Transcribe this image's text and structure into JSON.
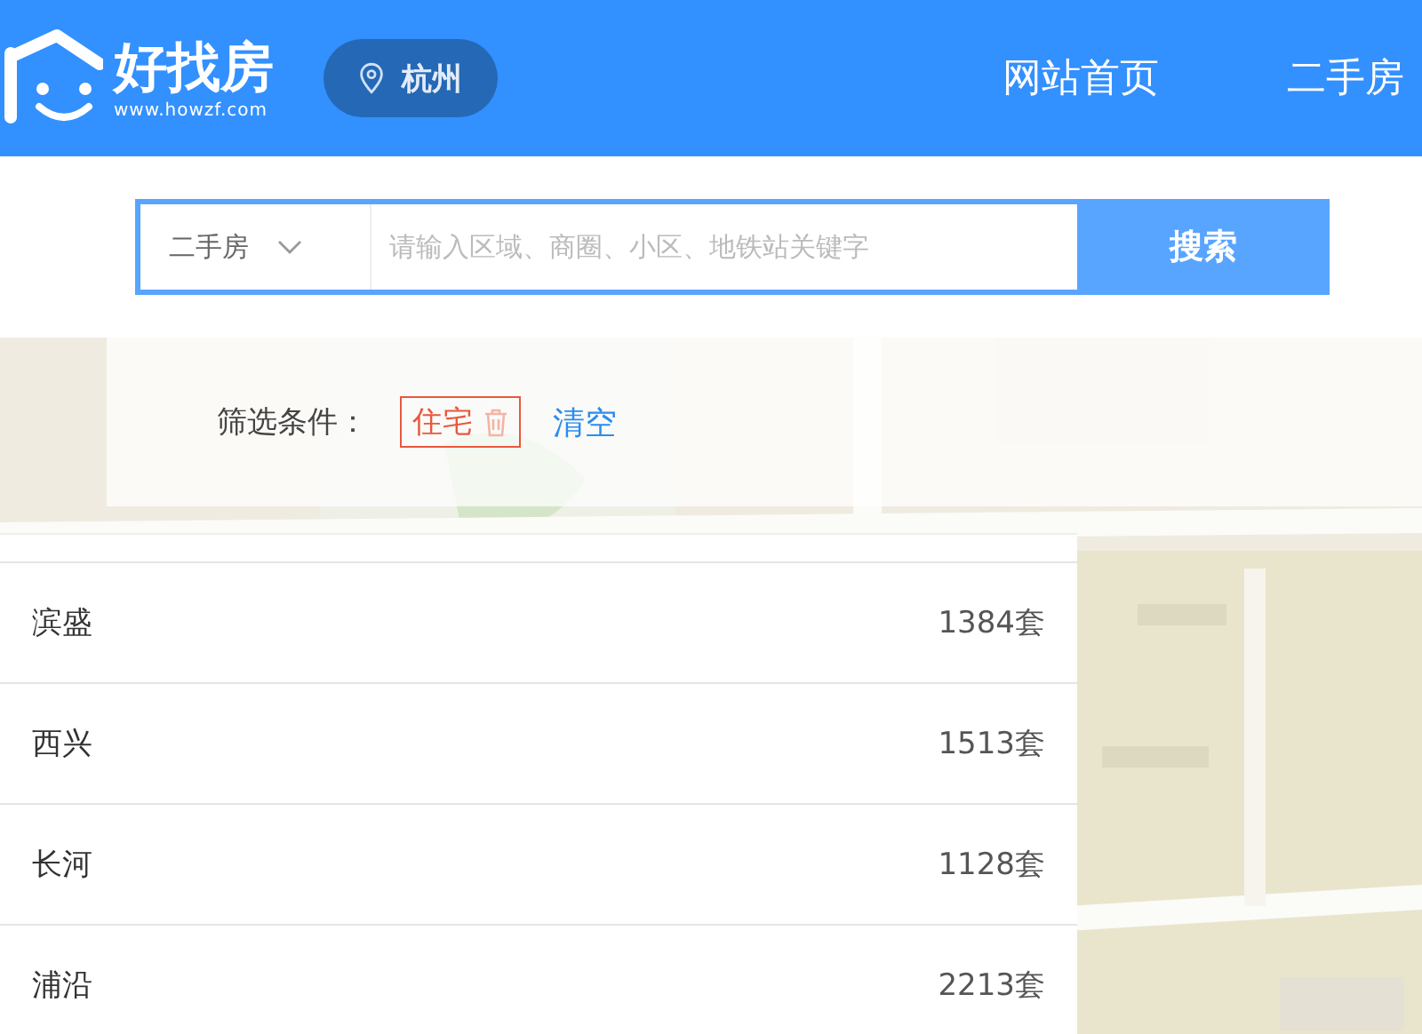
{
  "header": {
    "logo_title": "好找房",
    "logo_url": "www.howzf.com",
    "city": "杭州",
    "nav": [
      {
        "label": "网站首页",
        "selected": false
      },
      {
        "label": "二手房",
        "selected": false
      }
    ]
  },
  "search": {
    "category": "二手房",
    "placeholder": "请输入区域、商圈、小区、地铁站关键字",
    "button": "搜索"
  },
  "filter": {
    "label": "筛选条件：",
    "tags": [
      {
        "label": "住宅"
      }
    ],
    "clear": "清空"
  },
  "areas": [
    {
      "name": "滨盛",
      "count": "1384套"
    },
    {
      "name": "西兴",
      "count": "1513套"
    },
    {
      "name": "长河",
      "count": "1128套"
    },
    {
      "name": "浦沿",
      "count": "2213套"
    }
  ]
}
